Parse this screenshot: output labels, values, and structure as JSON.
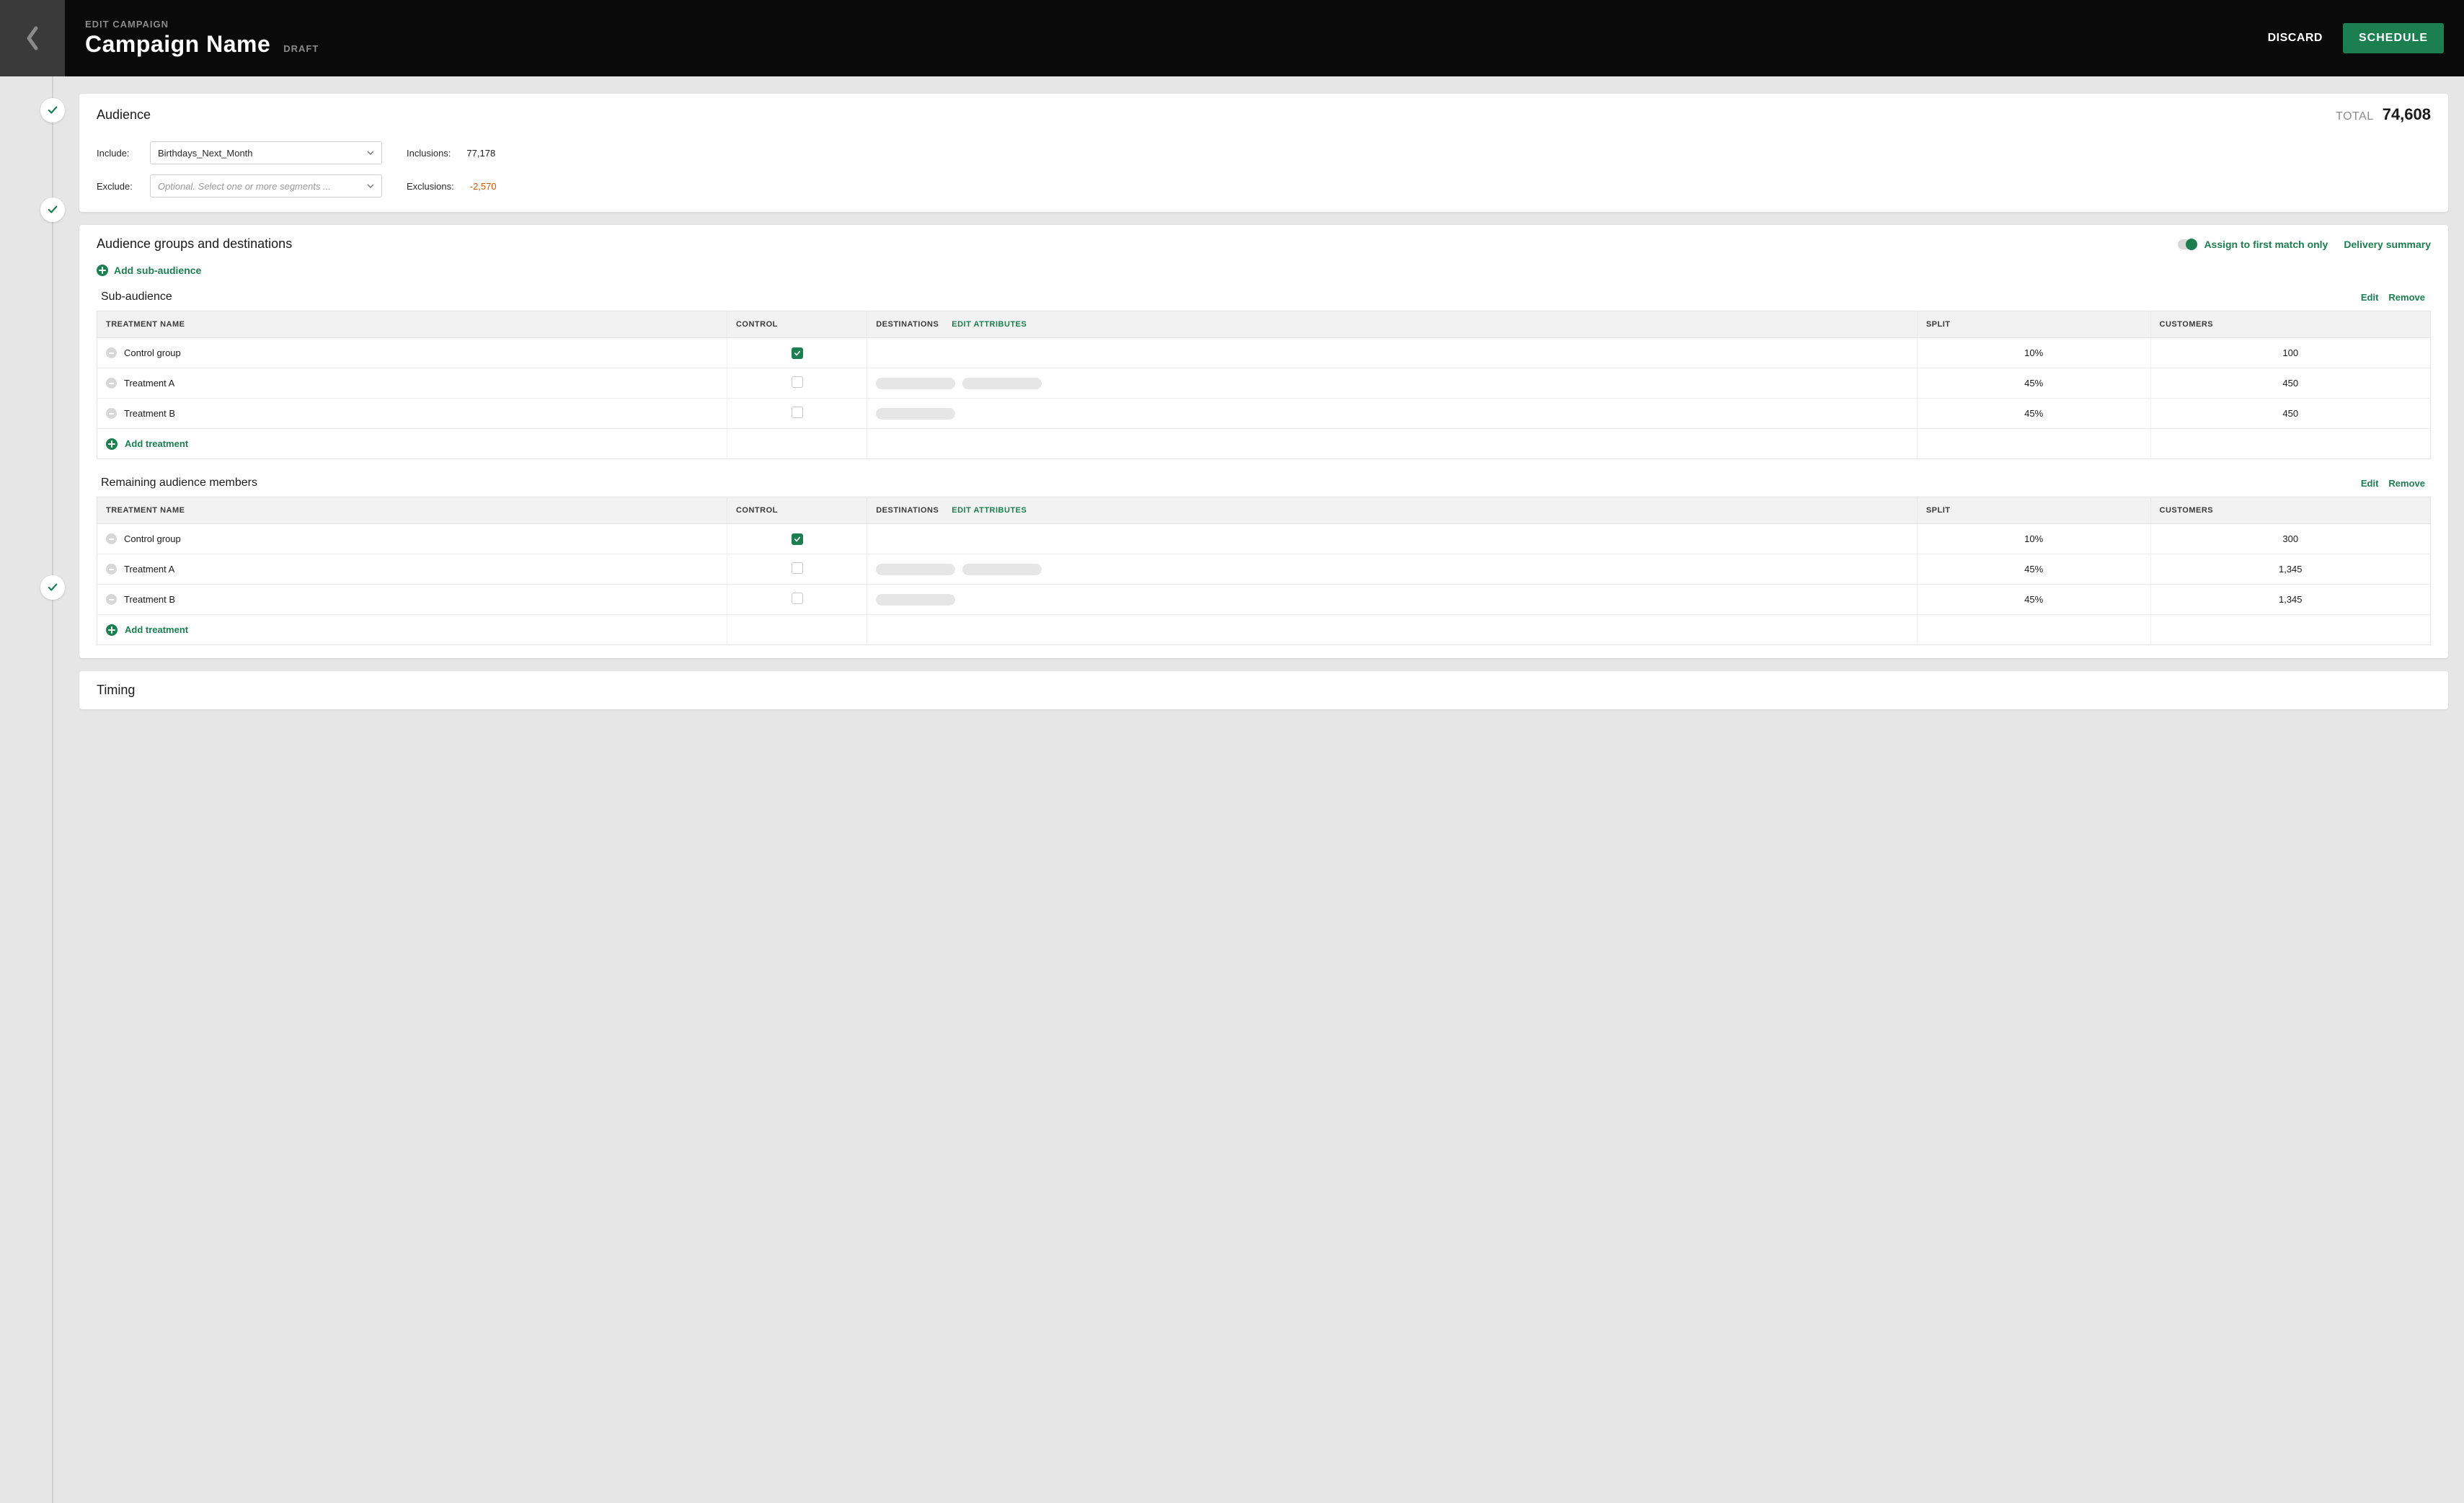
{
  "header": {
    "eyebrow": "EDIT CAMPAIGN",
    "title": "Campaign Name",
    "status": "DRAFT",
    "discard": "DISCARD",
    "schedule": "SCHEDULE"
  },
  "audience": {
    "title": "Audience",
    "total_label": "TOTAL",
    "total_value": "74,608",
    "include_label": "Include:",
    "include_value": "Birthdays_Next_Month",
    "exclude_label": "Exclude:",
    "exclude_placeholder": "Optional. Select one or more segments ...",
    "inclusions_label": "Inclusions:",
    "inclusions_value": "77,178",
    "exclusions_label": "Exclusions:",
    "exclusions_value": "-2,570"
  },
  "groups": {
    "title": "Audience groups and destinations",
    "assign_label": "Assign to first match only",
    "delivery_summary": "Delivery summary",
    "add_sub_audience": "Add sub-audience",
    "columns": {
      "treatment_name": "TREATMENT NAME",
      "control": "CONTROL",
      "destinations": "DESTINATIONS",
      "edit_attributes": "EDIT ATTRIBUTES",
      "split": "SPLIT",
      "customers": "CUSTOMERS"
    },
    "actions": {
      "edit": "Edit",
      "remove": "Remove",
      "add_treatment": "Add treatment"
    },
    "sub1": {
      "title": "Sub-audience",
      "rows": [
        {
          "name": "Control group",
          "control": true,
          "dest_pills": 0,
          "split": "10%",
          "customers": "100"
        },
        {
          "name": "Treatment A",
          "control": false,
          "dest_pills": 2,
          "split": "45%",
          "customers": "450"
        },
        {
          "name": "Treatment B",
          "control": false,
          "dest_pills": 1,
          "split": "45%",
          "customers": "450"
        }
      ]
    },
    "sub2": {
      "title": "Remaining audience members",
      "rows": [
        {
          "name": "Control group",
          "control": true,
          "dest_pills": 0,
          "split": "10%",
          "customers": "300"
        },
        {
          "name": "Treatment A",
          "control": false,
          "dest_pills": 2,
          "split": "45%",
          "customers": "1,345"
        },
        {
          "name": "Treatment B",
          "control": false,
          "dest_pills": 1,
          "split": "45%",
          "customers": "1,345"
        }
      ]
    }
  },
  "timing": {
    "title": "Timing"
  }
}
